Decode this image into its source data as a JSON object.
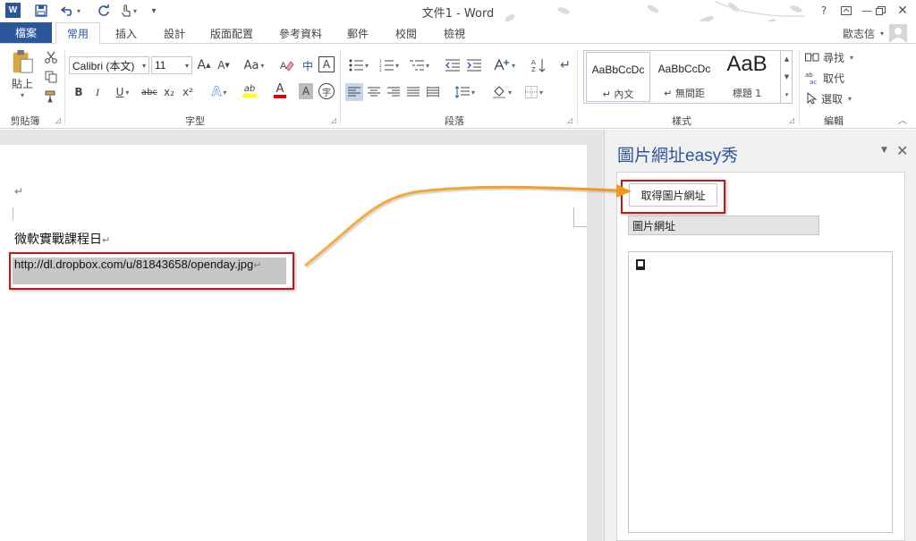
{
  "window": {
    "title": "文件1 - Word",
    "app_logo": "W",
    "controls": [
      "?",
      "restore-ribbon",
      "minimize",
      "restore",
      "close"
    ]
  },
  "quick_access": [
    "save-icon",
    "undo-icon",
    "redo-icon",
    "touch-mode-icon",
    "customize-icon"
  ],
  "tabs": {
    "file": "檔案",
    "items": [
      "常用",
      "插入",
      "設計",
      "版面配置",
      "參考資料",
      "郵件",
      "校閱",
      "檢視"
    ],
    "active": "常用"
  },
  "user": {
    "name": "歐志信"
  },
  "ribbon": {
    "clipboard": {
      "label": "剪貼簿",
      "paste": "貼上"
    },
    "font": {
      "label": "字型",
      "font_name": "Calibri (本文)",
      "font_size": "11",
      "change_case": "Aa",
      "bold": "B",
      "italic": "I",
      "underline": "U",
      "strike": "abc",
      "subscript": "x₂",
      "superscript": "x²",
      "text_effect": "A",
      "highlight": "ab",
      "font_color": "A",
      "char_shading": "A",
      "enclose": "字",
      "grow": "A",
      "shrink": "A",
      "phonetic": "中",
      "char_border": "A",
      "highlight_color": "#ffff00",
      "font_color_value": "#e00000"
    },
    "paragraph": {
      "label": "段落"
    },
    "styles": {
      "label": "樣式",
      "items": [
        {
          "sample": "AaBbCcDc",
          "name": "↵ 內文"
        },
        {
          "sample": "AaBbCcDc",
          "name": "↵ 無間距"
        },
        {
          "sample": "AaB",
          "name": "標題 1"
        }
      ]
    },
    "editing": {
      "label": "編輯",
      "find": "尋找",
      "replace": "取代",
      "select": "選取"
    }
  },
  "document": {
    "empty_paragraph": "↵",
    "paragraph1": "微軟實戰課程日",
    "paragraph1_mark": "↵",
    "url_text": "http://dl.dropbox.com/u/81843658/openday.jpg",
    "url_mark": "↵"
  },
  "task_pane": {
    "title": "圖片網址easy秀",
    "get_url_button": "取得圖片網址",
    "url_field_value": "圖片網址",
    "preview_icon": "broken-image-icon"
  },
  "colors": {
    "word_blue": "#2b579a",
    "annotation_red": "#b91c1c",
    "arrow_orange": "#f0a030"
  }
}
